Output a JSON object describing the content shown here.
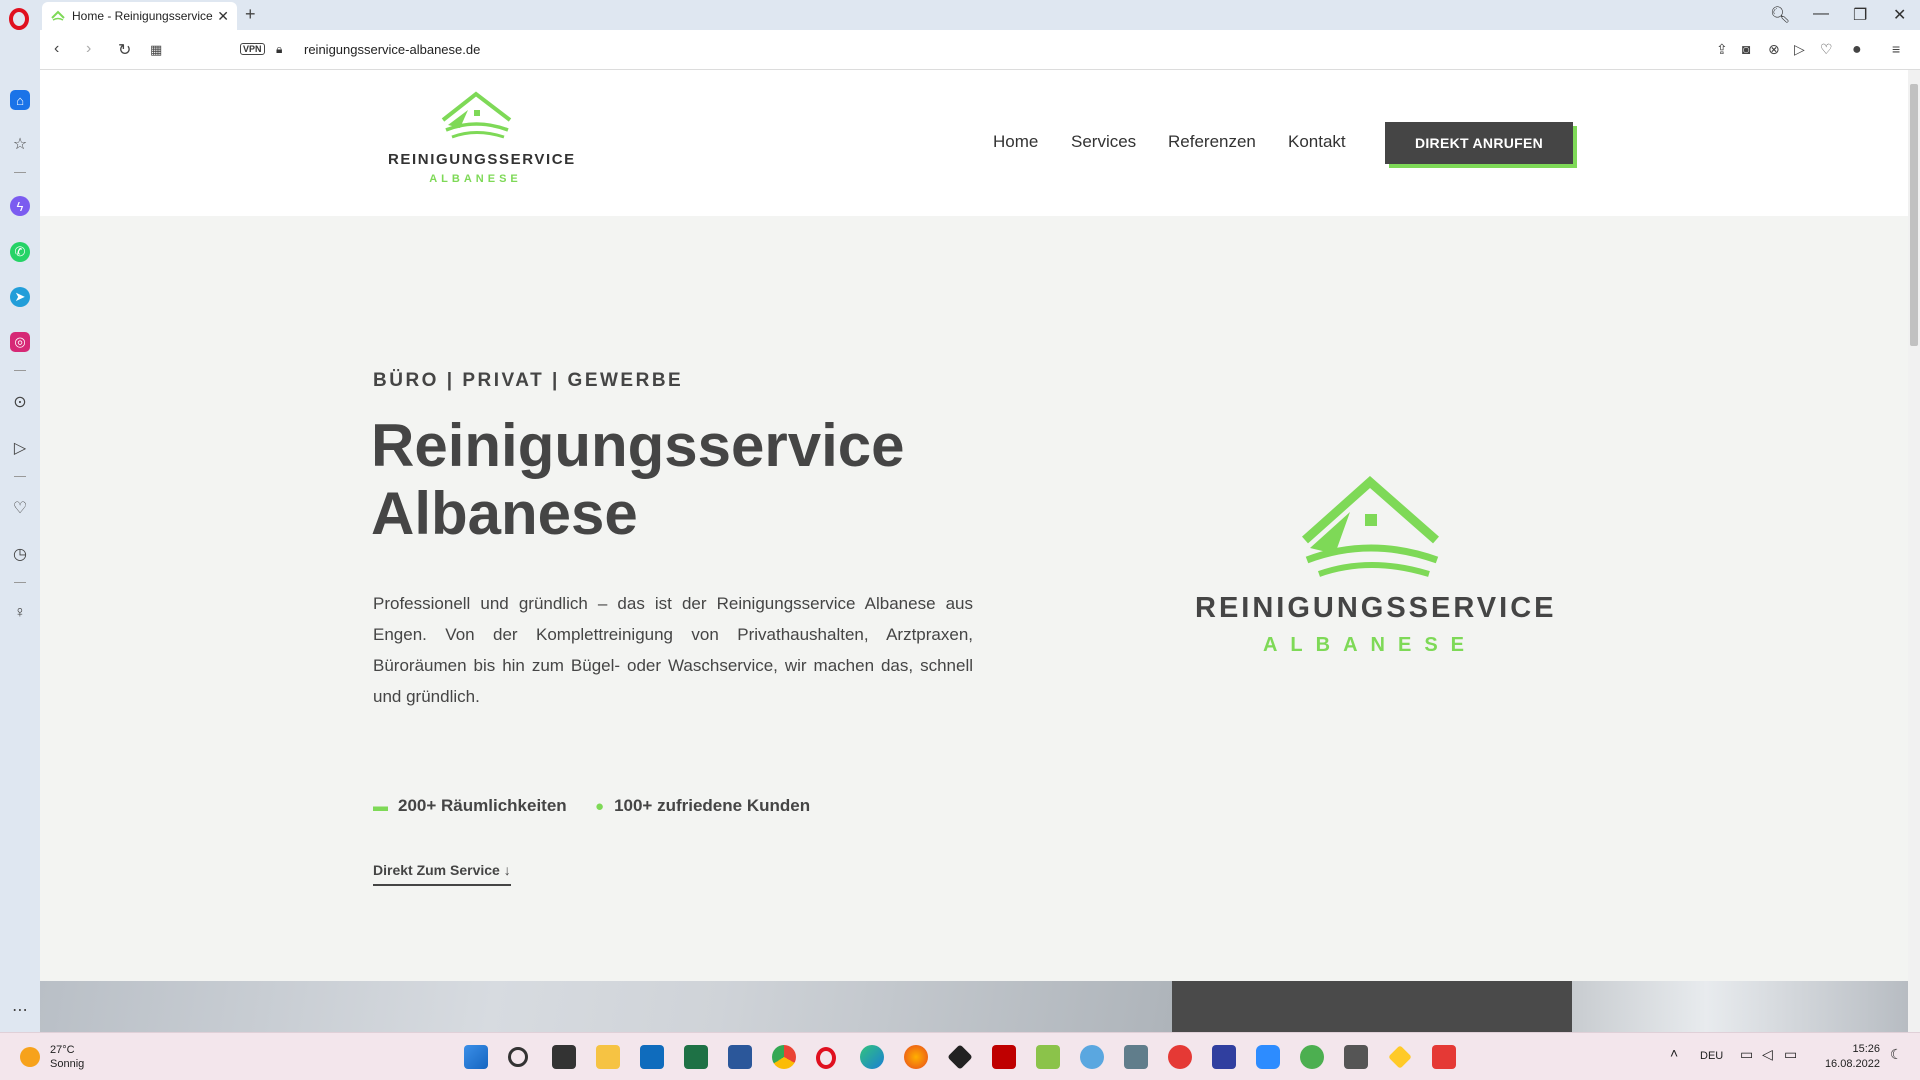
{
  "browser": {
    "tab_title": "Home - Reinigungsservice",
    "url": "reinigungsservice-albanese.de",
    "vpn_label": "VPN"
  },
  "site": {
    "logo_line1": "REINIGUNGSSERVICE",
    "logo_line2": "ALBANESE",
    "nav": [
      "Home",
      "Services",
      "Referenzen",
      "Kontakt"
    ],
    "cta": "DIREKT ANRUFEN"
  },
  "hero": {
    "eyebrow": "BÜRO | PRIVAT | GEWERBE",
    "title_line1": "Reinigungsservice",
    "title_line2": "Albanese",
    "description": "Professionell und gründlich – das ist der Reinigungsservice Albanese aus Engen. Von der Komplettreinigung von Privathaushalten, Arztpraxen, Büroräumen bis hin zum Bügel- oder Waschservice, wir machen das, schnell und gründlich.",
    "stats": [
      {
        "icon": "sofa-icon",
        "label": "200+ Räumlichkeiten"
      },
      {
        "icon": "user-icon",
        "label": "100+ zufriedene Kunden"
      }
    ],
    "scroll_link": "Direkt Zum Service",
    "brand_line1": "REINIGUNGSSERVICE",
    "brand_line2": "ALBANESE"
  },
  "colors": {
    "accent": "#7ed957",
    "dark": "#454545",
    "hero_bg": "#f3f4f2"
  },
  "taskbar": {
    "temperature": "27°C",
    "weather": "Sonnig",
    "language": "DEU",
    "time": "15:26",
    "date": "16.08.2022"
  }
}
